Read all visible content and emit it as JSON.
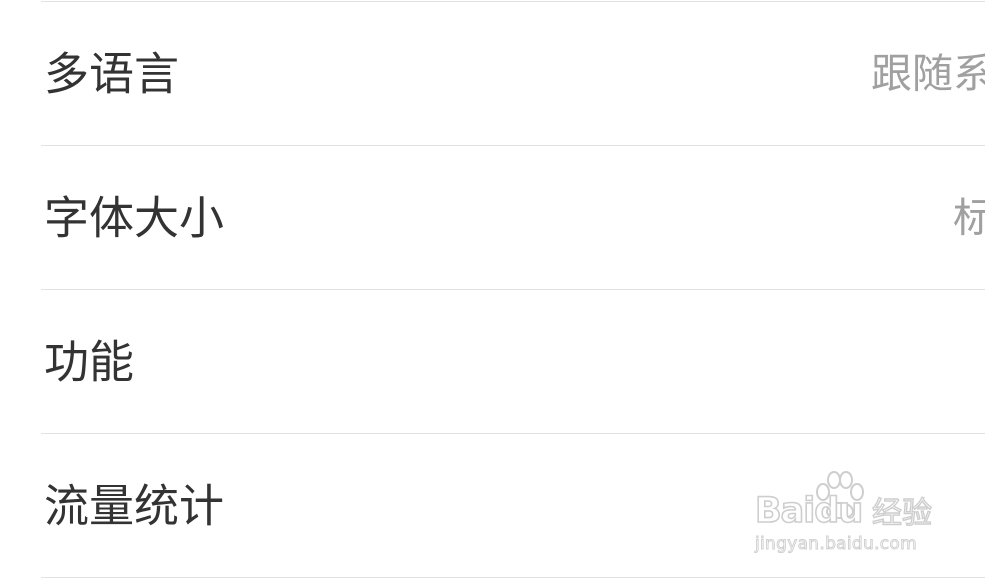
{
  "settings": {
    "rows": [
      {
        "label": "多语言",
        "value": "跟随系"
      },
      {
        "label": "字体大小",
        "value": "标"
      },
      {
        "label": "功能",
        "value": ""
      },
      {
        "label": "流量统计",
        "value": ""
      }
    ]
  },
  "watermark": {
    "brand": "Bai",
    "brand_suffix": "du",
    "product": "经验",
    "url": "jingyan.baidu.com"
  },
  "colors": {
    "label": "#333333",
    "value": "#a0a0a0",
    "divider": "#e2e2e2",
    "background": "#ffffff"
  }
}
